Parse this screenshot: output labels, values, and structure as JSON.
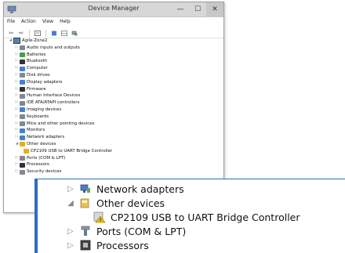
{
  "window": {
    "title": "Device Manager",
    "controls": {
      "minimize": "—",
      "maximize": "☐",
      "close": "✕"
    }
  },
  "menu": {
    "file": "File",
    "action": "Action",
    "view": "View",
    "help": "Help"
  },
  "toolbar": {
    "back": "⇦",
    "forward": "⇨"
  },
  "tree": {
    "root": "Agile-Zone2",
    "categories": [
      "Audio inputs and outputs",
      "Batteries",
      "Bluetooth",
      "Computer",
      "Disk drives",
      "Display adapters",
      "Firmware",
      "Human Interface Devices",
      "IDE ATA/ATAPI controllers",
      "Imaging devices",
      "Keyboards",
      "Mice and other pointing devices",
      "Monitors",
      "Network adapters",
      "Other devices"
    ],
    "other_device": "CP2109 USB to UART Bridge Controller",
    "after": [
      "Ports (COM & LPT)",
      "Processors",
      "Security devices"
    ]
  },
  "zoom": {
    "network": "Network adapters",
    "other": "Other devices",
    "device": "CP2109 USB to UART Bridge Controller",
    "ports": "Ports (COM & LPT)",
    "processors": "Processors"
  },
  "colors": {
    "accent": "#2c6cc4",
    "warning": "#e0b020"
  }
}
